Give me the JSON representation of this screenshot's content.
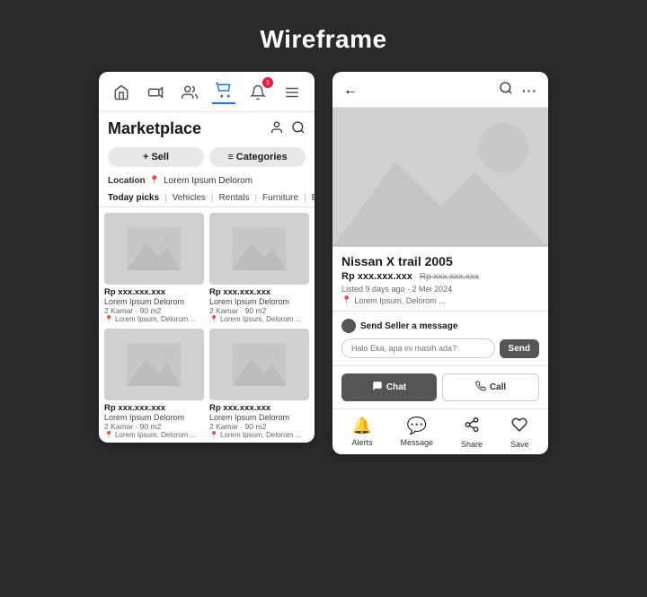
{
  "page": {
    "title": "Wireframe",
    "background": "#2a2a2a"
  },
  "left_panel": {
    "title": "Marketplace",
    "nav_icons": [
      "home",
      "video",
      "people",
      "marketplace",
      "notification",
      "menu"
    ],
    "notification_badge": "1",
    "btn_sell": "+ Sell",
    "btn_categories": "≡ Categories",
    "location_label": "Location",
    "location_value": "Lorem Ipsum Delorom",
    "tabs": [
      "Today picks",
      "Vehicles",
      "Rentals",
      "Furniture",
      "E"
    ],
    "products": [
      {
        "price": "Rp xxx.xxx.xxx",
        "name": "Lorem Ipsum Delorom",
        "detail1": "2 Kamar · 90 m2",
        "location": "Lorem Ipsum, Delorom ..."
      },
      {
        "price": "Rp xxx.xxx.xxx",
        "name": "Lorem Ipsum Delorom",
        "detail1": "2 Kamar · 90 m2",
        "location": "Lorem Ipsum, Delorom ..."
      },
      {
        "price": "Rp xxx.xxx.xxx",
        "name": "Lorem Ipsum Delorom",
        "detail1": "2 Kamar · 90 m2",
        "location": "Lorem Ipsum, Delorom ..."
      },
      {
        "price": "Rp xxx.xxx.xxx",
        "name": "Lorem Ipsum Delorom",
        "detail1": "2 Kamar · 90 m2",
        "location": "Lorem Ipsum, Delorom ..."
      }
    ]
  },
  "right_panel": {
    "back_icon": "←",
    "search_icon": "🔍",
    "more_icon": "···",
    "product_name": "Nissan X trail 2005",
    "price": "Rp xxx.xxx.xxx",
    "old_price": "Rp xxx.xxx.xxx",
    "listed": "Listed 9 days ago · 2 Mei 2024",
    "location": "Lorem Ipsum, Delorom ...",
    "message_label": "Send Seller a message",
    "message_placeholder": "Halo Eka, apa ini masih ada?",
    "send_label": "Send",
    "chat_label": "Chat",
    "call_label": "Call",
    "bottom_actions": [
      {
        "icon": "🔔",
        "label": "Alerts"
      },
      {
        "icon": "💬",
        "label": "Message"
      },
      {
        "icon": "➤",
        "label": "Share"
      },
      {
        "icon": "♥",
        "label": "Save"
      }
    ]
  }
}
